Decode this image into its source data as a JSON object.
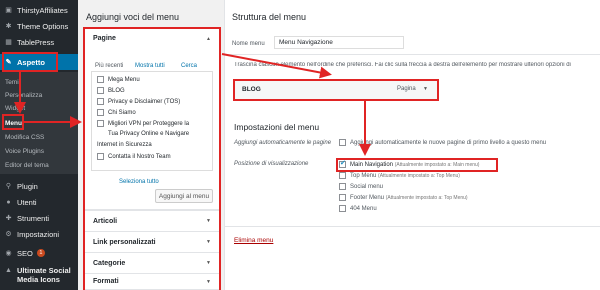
{
  "sidebar": {
    "items": [
      {
        "label": "ThirstyAffiliates",
        "icon": "ta-icon"
      },
      {
        "label": "Theme Options",
        "icon": "gear-icon"
      },
      {
        "label": "TablePress",
        "icon": "table-icon"
      },
      {
        "label": "Aspetto",
        "icon": "brush-icon"
      },
      {
        "label": "Plugin",
        "icon": "plugin-icon"
      },
      {
        "label": "Utenti",
        "icon": "user-icon"
      },
      {
        "label": "Strumenti",
        "icon": "wrench-icon"
      },
      {
        "label": "Impostazioni",
        "icon": "settings-icon"
      },
      {
        "label": "SEO",
        "icon": "seo-icon",
        "badge": "1"
      },
      {
        "label": "Ultimate Social Media Icons",
        "icon": "social-icon"
      }
    ],
    "submenu": [
      "Temi",
      "Personalizza",
      "Widget",
      "Menu",
      "Modifica CSS",
      "Voice Plugins",
      "Editor del tema"
    ]
  },
  "left": {
    "heading": "Aggiungi voci del menu",
    "pages_title": "Pagine",
    "tabs": [
      "Più recenti",
      "Mostra tutti",
      "Cerca"
    ],
    "pages": [
      "Mega Menu",
      "BLOG",
      "Privacy e Disclaimer (TOS)",
      "Chi Siamo",
      "Migliori VPN per Proteggere la",
      "Tua Privacy Online e Navigare",
      "Internet in Sicurezza",
      "Contatta il Nostro Team"
    ],
    "select_all": "Seleziona tutto",
    "add_button": "Aggiungi al menu",
    "sections": [
      "Articoli",
      "Link personalizzati",
      "Categorie",
      "Formati"
    ]
  },
  "right": {
    "heading": "Struttura del menu",
    "name_label": "Nome menu",
    "name_value": "Menu Navigazione",
    "instructions": "Trascina ciascun elemento nell'ordine che preferisci. Fai clic sulla freccia a destra dell'elemento per mostrare ulteriori opzioni di",
    "item_label": "BLOG",
    "item_type": "Pagina",
    "settings_heading": "Impostazioni del menu",
    "auto_add_label": "Aggiungi automaticamente le pagine",
    "auto_add_text": "Aggiungi automaticamente le nuove pagine di primo livello a questo menu",
    "position_label": "Posizione di visualizzazione",
    "locations": [
      {
        "name": "Main Navigation",
        "note": "(Attualmente impostato a: Main menu)",
        "checked": true
      },
      {
        "name": "Top Menu",
        "note": "(Attualmente impostato a: Top Menu)",
        "checked": false
      },
      {
        "name": "Social menu",
        "note": "",
        "checked": false
      },
      {
        "name": "Footer Menu",
        "note": "(Attualmente impostato a: Top Menu)",
        "checked": false
      },
      {
        "name": "404 Menu",
        "note": "",
        "checked": false
      }
    ],
    "delete_link": "Elimina menu"
  },
  "colors": {
    "sidebar": "#23282d",
    "active": "#0073aa",
    "annotation": "#e02424",
    "link": "#0073aa"
  }
}
